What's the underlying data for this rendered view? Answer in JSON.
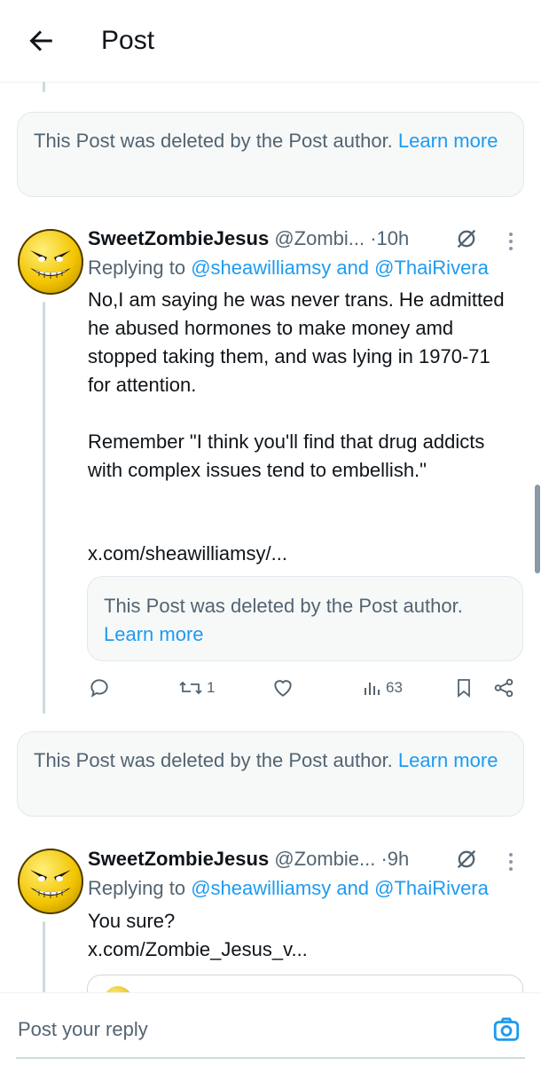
{
  "header": {
    "title": "Post"
  },
  "deleted_notice": {
    "highlight_text": "This Post was deleted by",
    "rest_text": " the Post author. ",
    "link_text": "Learn more"
  },
  "deleted_notice_inline": {
    "highlight_text": "This Post was deleted",
    "rest_text": " by the Post author.",
    "link_text": "Learn more"
  },
  "posts": [
    {
      "name": "SweetZombieJesus",
      "handle": "@Zombi...",
      "time": "·10h",
      "replying_prefix": "Replying to ",
      "replying_to": "@sheawilliamsy and @ThaiRivera",
      "body": "No,I am saying he was never trans. He admitted he abused hormones to make money amd stopped taking them, and was lying in 1970-71 for attention.\n\nRemember \"I think you'll find that drug addicts with complex issues tend to embellish.\"",
      "link": "x.com/sheawilliamsy/...",
      "actions": {
        "replies": "",
        "reposts": "1",
        "likes": "",
        "views": "63"
      }
    },
    {
      "name": "SweetZombieJesus",
      "handle": "@Zombie...",
      "time": "·9h",
      "replying_prefix": "Replying to ",
      "replying_to": "@sheawilliamsy and @ThaiRivera",
      "body": "You sure?",
      "link": "x.com/Zombie_Jesus_v..."
    }
  ],
  "reply": {
    "placeholder": "Post your reply"
  },
  "colors": {
    "link": "#1d9bf0",
    "muted": "#536471",
    "text": "#0f1419",
    "highlight": "#f0e850"
  },
  "icons": [
    "back-arrow-icon",
    "grok-slash-icon",
    "more-dots-icon",
    "reply-icon",
    "repost-icon",
    "like-icon",
    "views-icon",
    "bookmark-icon",
    "share-icon",
    "camera-icon"
  ]
}
